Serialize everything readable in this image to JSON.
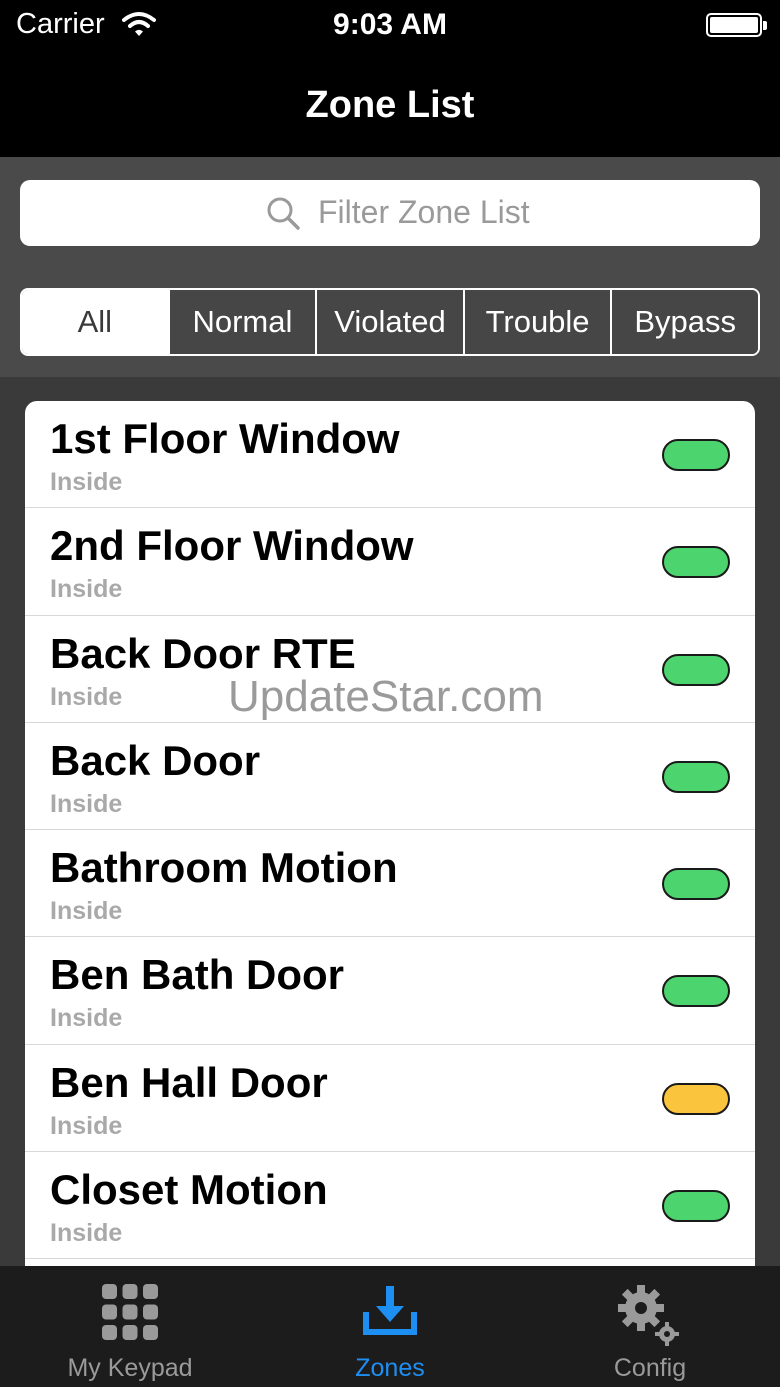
{
  "status_bar": {
    "carrier": "Carrier",
    "time": "9:03 AM"
  },
  "nav": {
    "title": "Zone List"
  },
  "search": {
    "placeholder": "Filter Zone List"
  },
  "segments": [
    "All",
    "Normal",
    "Violated",
    "Trouble",
    "Bypass"
  ],
  "selected_segment": "All",
  "zones": [
    {
      "name": "1st Floor Window",
      "location": "Inside",
      "status_color": "#4cd46e"
    },
    {
      "name": "2nd Floor Window",
      "location": "Inside",
      "status_color": "#4cd46e"
    },
    {
      "name": "Back Door RTE",
      "location": "Inside",
      "status_color": "#4cd46e"
    },
    {
      "name": "Back Door",
      "location": "Inside",
      "status_color": "#4cd46e"
    },
    {
      "name": "Bathroom Motion",
      "location": "Inside",
      "status_color": "#4cd46e"
    },
    {
      "name": "Ben Bath Door",
      "location": "Inside",
      "status_color": "#4cd46e"
    },
    {
      "name": "Ben Hall Door",
      "location": "Inside",
      "status_color": "#fbc43d"
    },
    {
      "name": "Closet Motion",
      "location": "Inside",
      "status_color": "#4cd46e"
    }
  ],
  "watermark": "UpdateStar.com",
  "tabs": [
    {
      "label": "My Keypad",
      "icon": "keypad-grid-icon",
      "active": false
    },
    {
      "label": "Zones",
      "icon": "download-tray-icon",
      "active": true
    },
    {
      "label": "Config",
      "icon": "gears-icon",
      "active": false
    }
  ],
  "colors": {
    "accent": "#1e8ff2",
    "status_normal": "#4cd46e",
    "status_trouble": "#fbc43d"
  }
}
